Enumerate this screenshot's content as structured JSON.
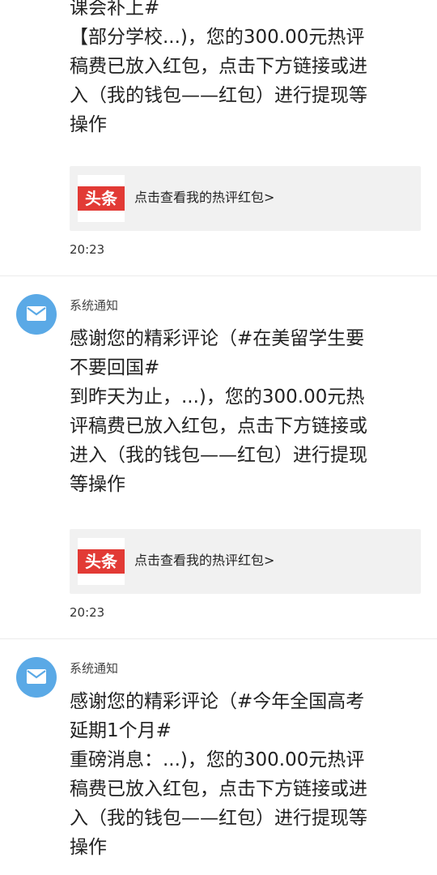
{
  "messages": [
    {
      "sender": "",
      "body": "课会补上#\n【部分学校...)，您的300.00元热评\n稿费已放入红包，点击下方链接或进\n入（我的钱包——红包）进行提现等\n操作",
      "card": {
        "logo_text": "头条",
        "link_text": "点击查看我的热评红包>"
      },
      "time": "20:23"
    },
    {
      "sender": "系统通知",
      "body": "感谢您的精彩评论（#在美留学生要\n不要回国#\n到昨天为止，...)，您的300.00元热\n评稿费已放入红包，点击下方链接或\n进入（我的钱包——红包）进行提现\n等操作",
      "card": {
        "logo_text": "头条",
        "link_text": "点击查看我的热评红包>"
      },
      "time": "20:23"
    },
    {
      "sender": "系统通知",
      "body": "感谢您的精彩评论（#今年全国高考\n延期1个月#\n重磅消息：...)，您的300.00元热评\n稿费已放入红包，点击下方链接或进\n入（我的钱包——红包）进行提现等\n操作",
      "card": {
        "logo_text": "",
        "link_text": ""
      },
      "time": ""
    }
  ],
  "colors": {
    "avatar": "#5aa9e6",
    "logo_red": "#e23a35",
    "card_bg": "#f1f1f1"
  },
  "icons": {
    "avatar": "envelope-icon"
  }
}
